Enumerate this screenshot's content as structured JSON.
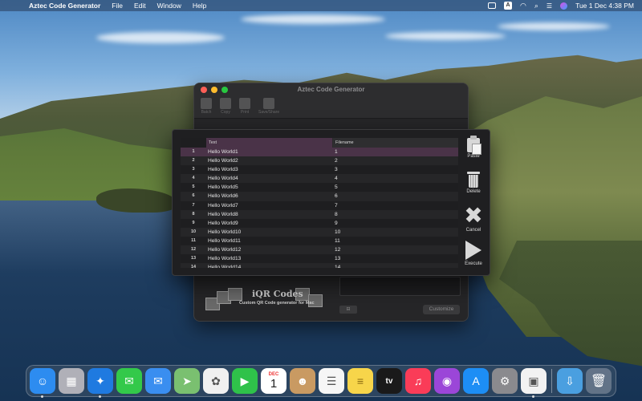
{
  "menubar": {
    "app_name": "Aztec Code Generator",
    "items": [
      "File",
      "Edit",
      "Window",
      "Help"
    ],
    "clock": "Tue 1 Dec  4:38 PM",
    "input_source": "A"
  },
  "window": {
    "title": "Aztec Code Generator",
    "toolbar": [
      {
        "label": "Batch",
        "icon": "batch-icon"
      },
      {
        "label": "Copy",
        "icon": "copy-icon"
      },
      {
        "label": "Print",
        "icon": "print-icon"
      },
      {
        "label": "Save/Share",
        "icon": "share-icon"
      }
    ],
    "promo_title": "iQR Codes",
    "promo_subtitle": "Custom QR Code generator for Mac",
    "customize_label": "Customize"
  },
  "sheet": {
    "columns": [
      "Text",
      "Filename"
    ],
    "rows": [
      {
        "n": "1",
        "text": "Hello World1",
        "file": "1"
      },
      {
        "n": "2",
        "text": "Hello World2",
        "file": "2"
      },
      {
        "n": "3",
        "text": "Hello World3",
        "file": "3"
      },
      {
        "n": "4",
        "text": "Hello World4",
        "file": "4"
      },
      {
        "n": "5",
        "text": "Hello World5",
        "file": "5"
      },
      {
        "n": "6",
        "text": "Hello World6",
        "file": "6"
      },
      {
        "n": "7",
        "text": "Hello World7",
        "file": "7"
      },
      {
        "n": "8",
        "text": "Hello World8",
        "file": "8"
      },
      {
        "n": "9",
        "text": "Hello World9",
        "file": "9"
      },
      {
        "n": "10",
        "text": "Hello World10",
        "file": "10"
      },
      {
        "n": "11",
        "text": "Hello World11",
        "file": "11"
      },
      {
        "n": "12",
        "text": "Hello World12",
        "file": "12"
      },
      {
        "n": "13",
        "text": "Hello World13",
        "file": "13"
      },
      {
        "n": "14",
        "text": "Hello World14",
        "file": "14"
      }
    ],
    "actions": {
      "paste": "Paste",
      "delete": "Delete",
      "cancel": "Cancel",
      "execute": "Execute"
    }
  },
  "dock": {
    "calendar_month": "DEC",
    "calendar_day": "1",
    "tv_label": "tv",
    "apps": [
      {
        "name": "finder-icon",
        "color": "#2d8cf0",
        "running": true
      },
      {
        "name": "launchpad-icon",
        "color": "#b0b0b8",
        "running": false
      },
      {
        "name": "safari-icon",
        "color": "#1f7ae0",
        "running": true
      },
      {
        "name": "messages-icon",
        "color": "#33c94a",
        "running": false
      },
      {
        "name": "mail-icon",
        "color": "#3a8ef0",
        "running": false
      },
      {
        "name": "maps-icon",
        "color": "#7ac070",
        "running": false
      },
      {
        "name": "photos-icon",
        "color": "#f0f0f0",
        "running": false
      },
      {
        "name": "facetime-icon",
        "color": "#2fc24a",
        "running": false
      },
      {
        "name": "calendar-icon",
        "color": "#ffffff",
        "running": false
      },
      {
        "name": "contacts-icon",
        "color": "#c99a62",
        "running": false
      },
      {
        "name": "reminders-icon",
        "color": "#f6f6f6",
        "running": false
      },
      {
        "name": "notes-icon",
        "color": "#f7d54a",
        "running": false
      },
      {
        "name": "apple-tv-icon",
        "color": "#1a1a1a",
        "running": false
      },
      {
        "name": "music-icon",
        "color": "#fa3c58",
        "running": false
      },
      {
        "name": "podcasts-icon",
        "color": "#9b46d8",
        "running": false
      },
      {
        "name": "app-store-icon",
        "color": "#1d8ef5",
        "running": false
      },
      {
        "name": "system-preferences-icon",
        "color": "#8a8a8e",
        "running": false
      },
      {
        "name": "aztec-code-generator-icon",
        "color": "#f2f2f2",
        "running": true
      }
    ]
  }
}
